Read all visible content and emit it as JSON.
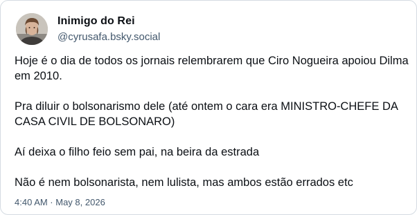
{
  "post": {
    "author": {
      "display_name": "Inimigo do Rei",
      "handle": "@cyrusafa.bsky.social",
      "avatar_icon": "user-avatar-photo"
    },
    "paragraphs": [
      "Hoje é o dia de todos os jornais relembrarem que Ciro Nogueira apoiou Dilma em 2010.",
      "Pra diluir o bolsonarismo dele (até ontem o cara era MINISTRO-CHEFE DA CASA CIVIL DE BOLSONARO)",
      "Aí deixa o filho feio sem pai, na beira da estrada",
      "Não é nem bolsonarista, nem lulista, mas ambos estão errados etc"
    ],
    "timestamp": "4:40 AM · May 8, 2026"
  },
  "colors": {
    "border": "#d4dbe2",
    "text": "#0b0f14",
    "muted": "#42576c"
  }
}
